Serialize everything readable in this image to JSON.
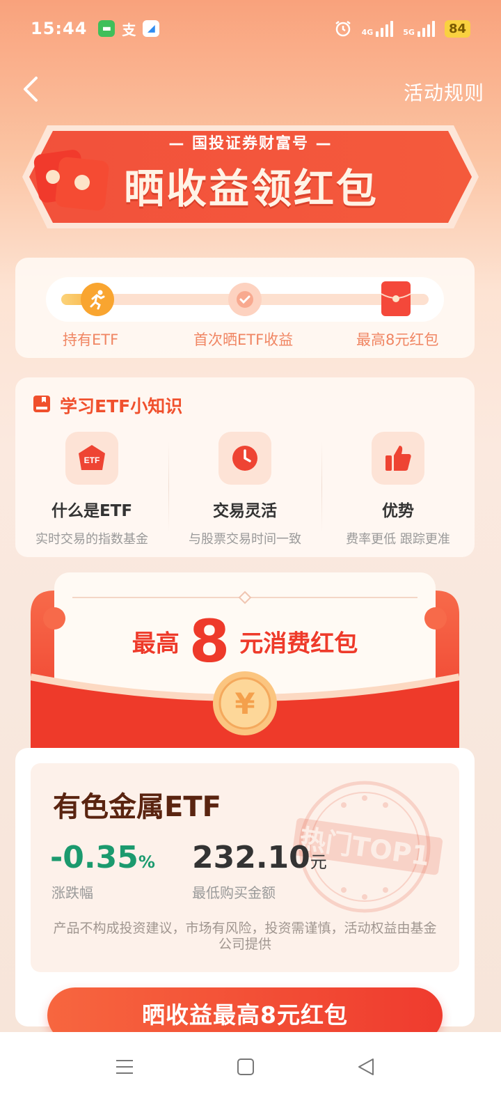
{
  "status_bar": {
    "time": "15:44",
    "apps": [
      {
        "icon": "message-app-icon",
        "color": "#3fbf5a",
        "glyph": "▬"
      },
      {
        "icon": "alipay-app-icon",
        "glyph": "支"
      },
      {
        "icon": "blue-app-icon",
        "color": "#2f8cf0",
        "glyph": "◢"
      }
    ],
    "network_1": "4G",
    "network_2": "5G",
    "battery": "84"
  },
  "header": {
    "back_icon": "chevron-left-icon",
    "rules_label": "活动规则"
  },
  "banner": {
    "subtitle": "— 国投证券财富号 —",
    "title": "晒收益领红包"
  },
  "progress": {
    "steps": [
      {
        "label": "持有ETF",
        "icon": "running-icon",
        "done": true
      },
      {
        "label": "首次晒ETF收益",
        "icon": "check-icon",
        "done": false
      },
      {
        "label": "最高8元红包",
        "icon": "red-packet-icon",
        "done": false
      }
    ]
  },
  "learn": {
    "title": "学习ETF小知识",
    "items": [
      {
        "name": "什么是ETF",
        "desc": "实时交易的指数基金",
        "icon": "etf-icon",
        "badge": "ETF"
      },
      {
        "name": "交易灵活",
        "desc": "与股票交易时间一致",
        "icon": "clock-icon"
      },
      {
        "name": "优势",
        "desc": "费率更低 跟踪更准",
        "icon": "thumbs-up-icon"
      }
    ]
  },
  "red_packet": {
    "prefix": "最高",
    "amount": "8",
    "suffix": "元消费红包",
    "coin_symbol": "¥"
  },
  "product": {
    "name": "有色金属ETF",
    "change_value": "-0.35",
    "change_unit": "%",
    "change_label": "涨跌幅",
    "min_amount_value": "232.10",
    "min_amount_unit": "元",
    "min_amount_label": "最低购买金额",
    "stamp_text": "热门TOP1",
    "disclaimer": "产品不构成投资建议，市场有风险，投资需谨慎，活动权益由基金公司提供"
  },
  "cta": {
    "label": "晒收益最高8元红包"
  },
  "colors": {
    "accent": "#ef3b2e",
    "positive_green": "#1b9a6e",
    "title_brown": "#5a2410"
  }
}
